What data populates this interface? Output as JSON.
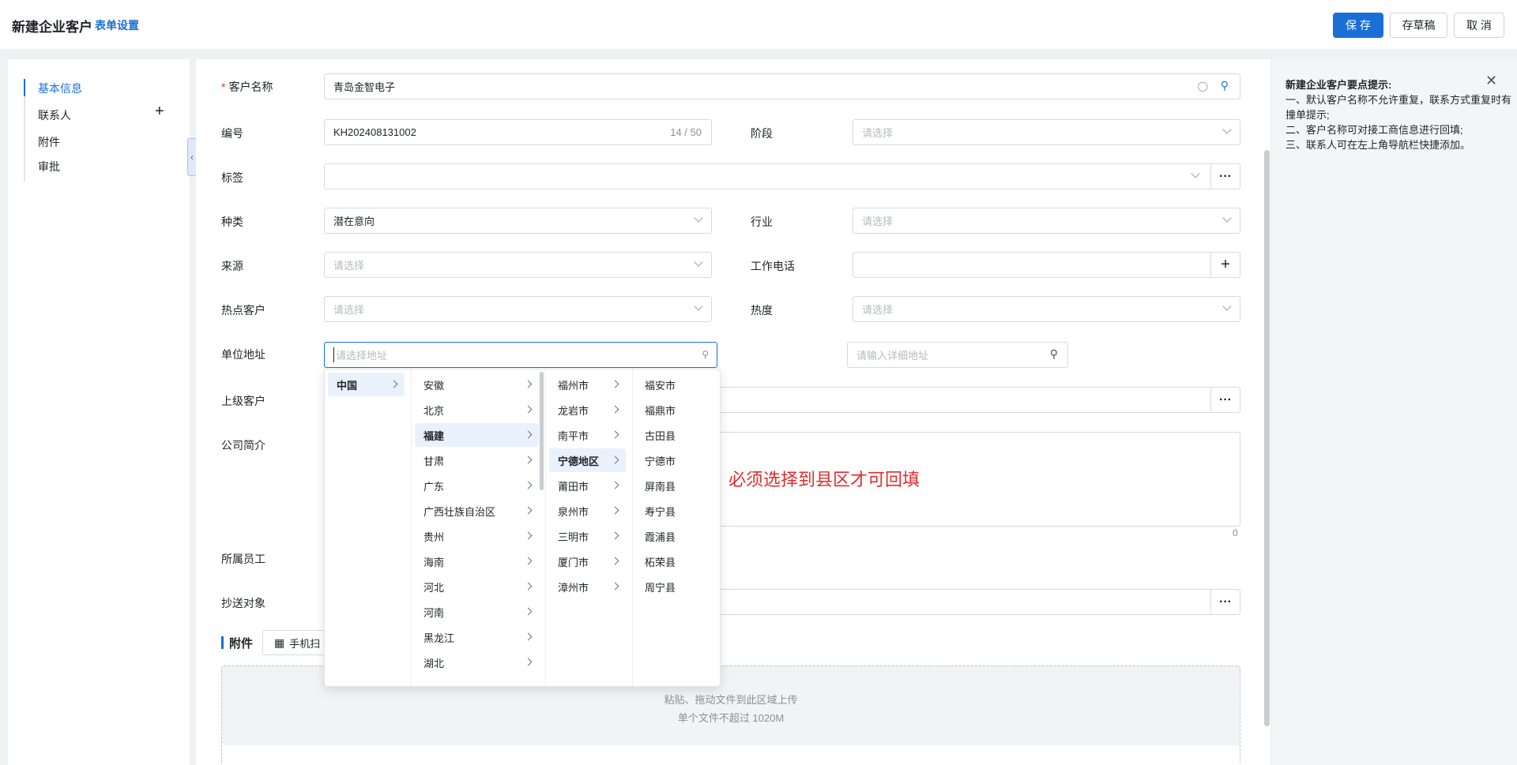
{
  "header": {
    "title": "新建企业客户",
    "form_settings": "表单设置",
    "save": "保 存",
    "draft": "存草稿",
    "cancel": "取 消"
  },
  "nav": {
    "items": [
      {
        "label": "基本信息",
        "active": true
      },
      {
        "label": "联系人"
      },
      {
        "label": "附件"
      },
      {
        "label": "审批"
      }
    ]
  },
  "form": {
    "customer_name": {
      "label": "客户名称",
      "value": "青岛金智电子"
    },
    "code": {
      "label": "编号",
      "value": "KH202408131002",
      "counter": "14 / 50"
    },
    "stage": {
      "label": "阶段",
      "placeholder": "请选择"
    },
    "tags": {
      "label": "标签"
    },
    "kind": {
      "label": "种类",
      "value": "潜在意向"
    },
    "industry": {
      "label": "行业",
      "placeholder": "请选择"
    },
    "source": {
      "label": "来源",
      "placeholder": "请选择"
    },
    "work_phone": {
      "label": "工作电话"
    },
    "hot_customer": {
      "label": "热点客户",
      "placeholder": "请选择"
    },
    "heat": {
      "label": "热度",
      "placeholder": "请选择"
    },
    "address": {
      "label": "单位地址",
      "placeholder": "请选择地址",
      "detail_placeholder": "请输入详细地址"
    },
    "parent_customer": {
      "label": "上级客户"
    },
    "intro": {
      "label": "公司简介",
      "count": "0"
    },
    "staff": {
      "label": "所属员工"
    },
    "cc": {
      "label": "抄送对象"
    }
  },
  "annotation": "必须选择到县区才可回填",
  "attachments": {
    "title": "附件",
    "scan_button": "手机扫",
    "upload_hint1": "粘贴、拖动文件到此区域上传",
    "upload_hint2": "单个文件不超过 1020M"
  },
  "cascader": {
    "countries": [
      "中国"
    ],
    "provinces": [
      "安徽",
      "北京",
      "福建",
      "甘肃",
      "广东",
      "广西壮族自治区",
      "贵州",
      "海南",
      "河北",
      "河南",
      "黑龙江",
      "湖北"
    ],
    "cities": [
      "福州市",
      "龙岩市",
      "南平市",
      "宁德地区",
      "莆田市",
      "泉州市",
      "三明市",
      "厦门市",
      "漳州市"
    ],
    "counties": [
      "福安市",
      "福鼎市",
      "古田县",
      "宁德市",
      "屏南县",
      "寿宁县",
      "霞浦县",
      "柘荣县",
      "周宁县"
    ],
    "selected_country": "中国",
    "selected_province": "福建",
    "selected_city": "宁德地区"
  },
  "tips": {
    "title": "新建企业客户要点提示:",
    "lines": [
      "一、默认客户名称不允许重复，联系方式重复时有撞单提示;",
      "二、客户名称可对接工商信息进行回填;",
      "三、联系人可在左上角导航栏快捷添加。"
    ]
  }
}
